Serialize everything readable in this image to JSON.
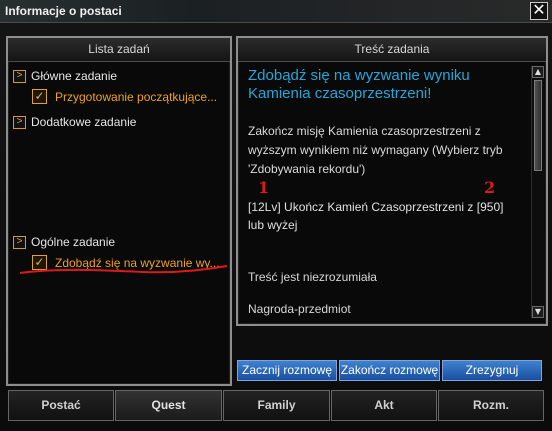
{
  "window": {
    "title": "Informacje o postaci",
    "close": "✕"
  },
  "left": {
    "header": "Lista zadań",
    "categories": [
      {
        "label": "Główne zadanie",
        "arrow": ">"
      },
      {
        "label": "Dodatkowe zadanie",
        "arrow": ">"
      },
      {
        "label": "Ogólne zadanie",
        "arrow": ">"
      }
    ],
    "quests": [
      {
        "label": "Przygotowanie początkujące...",
        "check": "✓"
      },
      {
        "label": "Zdobądź się na wyzwanie wy...",
        "check": "✓"
      }
    ]
  },
  "right": {
    "header": "Treść zadania",
    "title": "Zdobądź się na wyzwanie wyniku Kamienia czasoprzestrzeni!",
    "description": "Zakończ misję Kamienia czasoprzestrzeni z wyższym wynikiem niż wymagany (Wybierz tryb 'Zdobywania rekordu')",
    "requirement": "[12Lv] Ukończ Kamień Czasoprzestrzeni z [950] lub wyżej",
    "incomprehensible": "Treść jest niezrozumiała",
    "reward": "Nagroda-przedmiot",
    "annotations": [
      "1",
      "2"
    ],
    "scrollbar": {
      "up": "▲",
      "down": "▼"
    }
  },
  "buttons": {
    "start": "Zacznij rozmowę",
    "finish": "Zakończ rozmowę",
    "abandon": "Zrezygnuj"
  },
  "tabs": [
    "Postać",
    "Quest",
    "Family",
    "Akt",
    "Rozm."
  ],
  "colors": {
    "title_text": "#f1f1f1",
    "quest_title": "#25a6d8",
    "quest_orange": "#f0a11d",
    "button_blue": "#2f6fc1",
    "annotation_red": "#dd1a1a"
  }
}
